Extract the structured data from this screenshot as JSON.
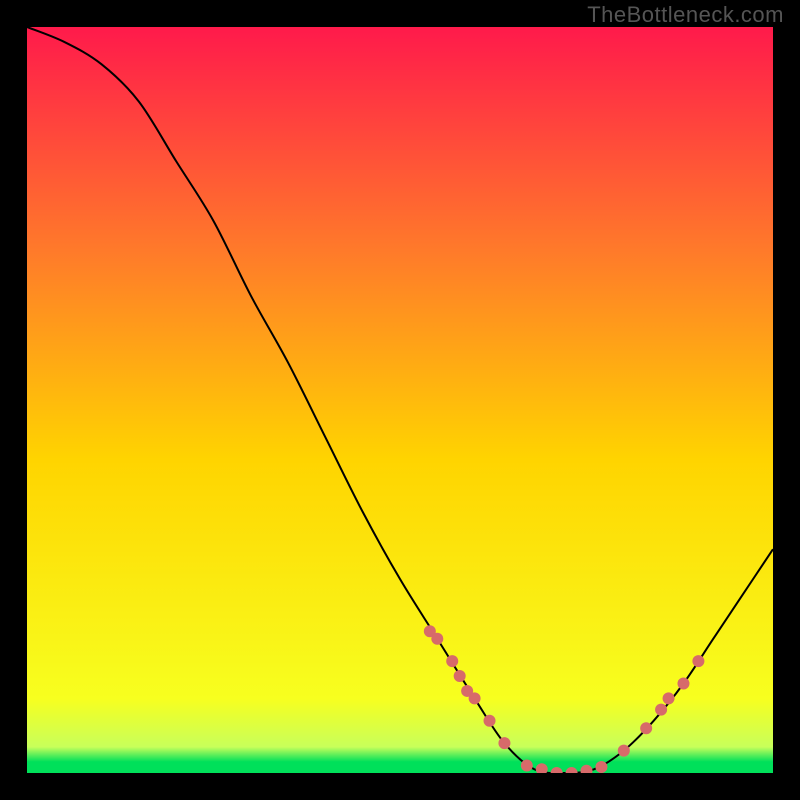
{
  "watermark": "TheBottleneck.com",
  "chart_data": {
    "type": "line",
    "title": "",
    "xlabel": "",
    "ylabel": "",
    "xlim": [
      0,
      100
    ],
    "ylim": [
      0,
      100
    ],
    "background_gradient": {
      "top": "#ff1a4b",
      "mid_upper": "#ff7a2a",
      "mid": "#ffd400",
      "mid_lower": "#f7ff1f",
      "bottom": "#00e05a"
    },
    "curve": [
      {
        "x": 0,
        "y": 100
      },
      {
        "x": 5,
        "y": 98
      },
      {
        "x": 10,
        "y": 95
      },
      {
        "x": 15,
        "y": 90
      },
      {
        "x": 20,
        "y": 82
      },
      {
        "x": 25,
        "y": 74
      },
      {
        "x": 30,
        "y": 64
      },
      {
        "x": 35,
        "y": 55
      },
      {
        "x": 40,
        "y": 45
      },
      {
        "x": 45,
        "y": 35
      },
      {
        "x": 50,
        "y": 26
      },
      {
        "x": 55,
        "y": 18
      },
      {
        "x": 60,
        "y": 10
      },
      {
        "x": 64,
        "y": 4
      },
      {
        "x": 68,
        "y": 0.5
      },
      {
        "x": 72,
        "y": 0
      },
      {
        "x": 76,
        "y": 0.5
      },
      {
        "x": 80,
        "y": 3
      },
      {
        "x": 84,
        "y": 7
      },
      {
        "x": 88,
        "y": 12
      },
      {
        "x": 92,
        "y": 18
      },
      {
        "x": 96,
        "y": 24
      },
      {
        "x": 100,
        "y": 30
      }
    ],
    "markers": [
      {
        "x": 54,
        "y": 19
      },
      {
        "x": 55,
        "y": 18
      },
      {
        "x": 57,
        "y": 15
      },
      {
        "x": 58,
        "y": 13
      },
      {
        "x": 59,
        "y": 11
      },
      {
        "x": 60,
        "y": 10
      },
      {
        "x": 62,
        "y": 7
      },
      {
        "x": 64,
        "y": 4
      },
      {
        "x": 67,
        "y": 1
      },
      {
        "x": 69,
        "y": 0.5
      },
      {
        "x": 71,
        "y": 0
      },
      {
        "x": 73,
        "y": 0
      },
      {
        "x": 75,
        "y": 0.3
      },
      {
        "x": 77,
        "y": 0.8
      },
      {
        "x": 80,
        "y": 3
      },
      {
        "x": 83,
        "y": 6
      },
      {
        "x": 85,
        "y": 8.5
      },
      {
        "x": 86,
        "y": 10
      },
      {
        "x": 88,
        "y": 12
      },
      {
        "x": 90,
        "y": 15
      }
    ],
    "marker_color": "#d76a6a",
    "curve_color": "#000000"
  }
}
